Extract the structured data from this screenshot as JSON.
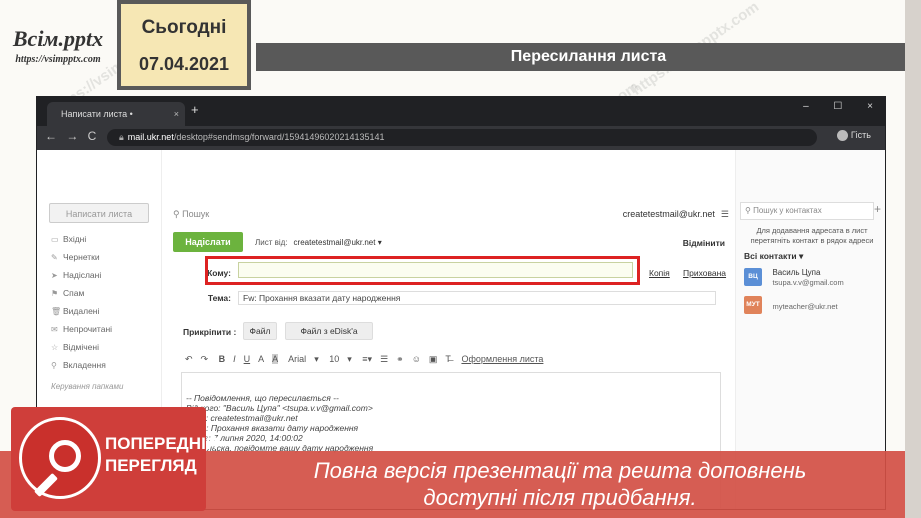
{
  "brand": {
    "logo_title": "Всім.pptx",
    "logo_url": "https://vsimpptx.com"
  },
  "date_box": {
    "label": "Сьогодні",
    "date": "07.04.2021"
  },
  "slide_title": "Пересилання листа",
  "browser": {
    "tab_title": "Написати листа • createtestmail",
    "tab_close": "×",
    "new_tab": "+",
    "window_controls": "– ☐ ×",
    "nav": "← → C",
    "url_host": "mail.ukr.net",
    "url_path": "/desktop#sendmsg/forward/15941496020214135141",
    "guest_label": "Гість"
  },
  "mail": {
    "write_button": "Написати листа",
    "folders": [
      "Вхідні",
      "Чернетки",
      "Надіслані",
      "Спам",
      "Видалені",
      "Непрочитані",
      "Відмічені",
      "Вкладення"
    ],
    "manage_folders": "Керування папками",
    "search_placeholder": "Пошук",
    "account": "createtestmail@ukr.net",
    "send_button": "Надіслати",
    "from_label": "Лист від:",
    "from_value": "createtestmail@ukr.net ▾",
    "cancel": "Відмінити",
    "to_label": "Кому:",
    "cc_link": "Копія",
    "bcc_link": "Прихована",
    "subject_label": "Тема:",
    "subject_value": "Fw: Прохання вказати дату народження",
    "attach_label": "Прикріпити :",
    "attach_file": "Файл",
    "attach_edisk": "Файл з eDisk'a",
    "toolbar": {
      "font": "Arial",
      "size": "10",
      "format": "Оформлення листа"
    },
    "body_lines": [
      "-- Повідомлення, що пересилається --",
      "Від кого: \"Василь Цупа\" <tsupa.v.v@gmail.com>",
      "Кому: createtestmail@ukr.net",
      "Тема: Прохання вказати дату народження",
      "Дата: 7 липня 2020, 14:00:02",
      "Будь ласка, повідомте вашу дату народження"
    ],
    "body_from_email": "tsupa.v.v@gmail.com",
    "body_to_email": "createtestmail@ukr.net"
  },
  "contacts": {
    "search_placeholder": "Пошук у контактах",
    "add": "+",
    "hint": "Для додавання адресата в лист перетягніть контакт в рядок адреси",
    "all_contacts": "Всі контакти ▾",
    "items": [
      {
        "initials": "ВЦ",
        "name": "Василь Цупа",
        "email": "tsupa.v.v@gmail.com",
        "color": "#5b8fd6"
      },
      {
        "initials": "МУТ",
        "name": "",
        "email": "myteacher@ukr.net",
        "color": "#e0835a"
      }
    ]
  },
  "preview_badge": {
    "line1": "ПОПЕРЕДНІЙ",
    "line2": "ПЕРЕГЛЯД"
  },
  "promo_text": {
    "line1": "Повна версія презентації та решта доповнень",
    "line2": "доступні після придбання."
  },
  "colors": {
    "banner": "#d34f44",
    "send_green": "#6cb33e",
    "highlight_red": "#dd2222",
    "title_bar": "#595959"
  },
  "watermark": "https://vsimpptx.com"
}
